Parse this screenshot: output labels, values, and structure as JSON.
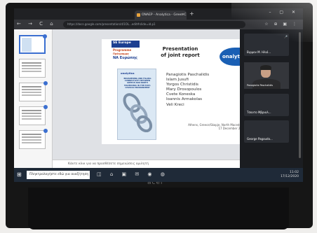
{
  "browser": {
    "tab_title": "ΟΝΑΕΡ - Analytica - Green C",
    "url": "https://docs.google.com/presentation/d/1OL...edit#slide=id.p1",
    "nav_icons": "← → C ⌂",
    "ext_icons": "☆ ⊕ ▣ ⋮",
    "window_controls": "– ▢ ✕"
  },
  "slide": {
    "eu_banner": "SE Europe",
    "programme": "Programme",
    "programme_gr": "Πρόγραμμα",
    "greek_brand": "ΝΑ Ευρώπης",
    "title": "Presentation of joint report",
    "partner_logo": "onalytica",
    "cover_logo": "onalytica",
    "cover_title": "BROADENING AND FILLING CONNECTIVITY BETWEEN GREECE AND NORTH MACEDONIA IN THE POST-COVID19 ENVIRONMENT",
    "authors": [
      "Panagiotis Paschalidis",
      "Islam Jusufi",
      "Yorgos Christidis",
      "Mary Drosopoulos",
      "Cvete Koneska",
      "Ioannis Armakolas",
      "Veli Kreci"
    ],
    "place": "Athens, Greece/Skopje, North Macedonia",
    "date": "17 December 2020"
  },
  "notes_placeholder": "Κάντε κλικ για να προσθέσετε σημειώσεις ομιλητή",
  "call": {
    "participants": [
      {
        "name": "Βιρμον Μ. Ηλιό..."
      },
      {
        "name": "Panagiotis Paschalidis"
      },
      {
        "name": "Τσαντο Μβριολ..."
      },
      {
        "name": "George Pagoudo..."
      }
    ]
  },
  "taskbar": {
    "search_placeholder": "Πληκτρολογήστε εδώ για αναζήτηση",
    "icons": "◫ ⌂ ▣ ✉ ◉ ◍",
    "time": "11:02",
    "date": "17/12/2020"
  },
  "device": {
    "brand": "acer"
  }
}
